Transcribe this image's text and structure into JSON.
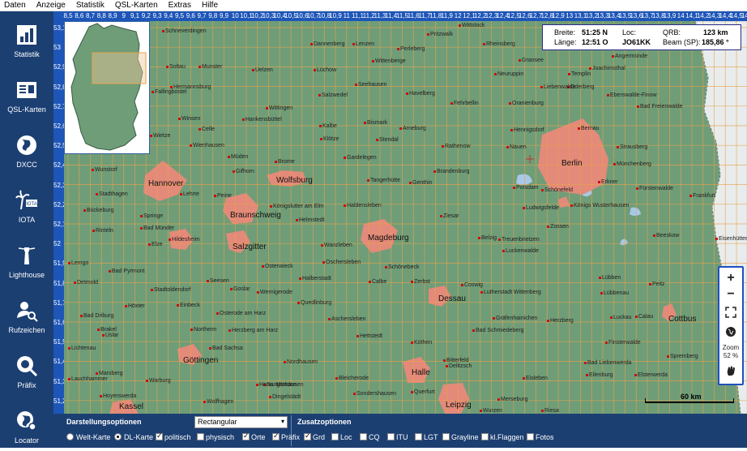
{
  "menu": [
    "Daten",
    "Anzeige",
    "Statistik",
    "QSL-Karten",
    "Extras",
    "Hilfe"
  ],
  "sidebar": [
    {
      "label": "Statistik",
      "icon": "chart-icon"
    },
    {
      "label": "QSL-Karten",
      "icon": "qsl-card-icon"
    },
    {
      "label": "DXCC",
      "icon": "globe-icon"
    },
    {
      "label": "IOTA",
      "icon": "iota-palm-icon"
    },
    {
      "label": "Lighthouse",
      "icon": "lighthouse-icon"
    },
    {
      "label": "Rufzeichen",
      "icon": "person-search-icon"
    },
    {
      "label": "Präfix",
      "icon": "globe-search-icon"
    },
    {
      "label": "Locator",
      "icon": "globe-pin-icon"
    }
  ],
  "ruler_top": [
    "8,5",
    "8,6",
    "8,7",
    "8,8",
    "8,9",
    "9",
    "9,1",
    "9,2",
    "9,3",
    "9,4",
    "9,5",
    "9,6",
    "9,7",
    "9,8",
    "9,9",
    "10",
    "10,1",
    "10,2",
    "10,3",
    "10,4",
    "10,5",
    "10,6",
    "10,7",
    "10,8",
    "10,9",
    "11",
    "11,1",
    "11,2",
    "11,3",
    "11,4",
    "11,5",
    "11,6",
    "11,7",
    "11,8",
    "11,9",
    "12",
    "12,1",
    "12,2",
    "12,3",
    "12,4",
    "12,5",
    "12,6",
    "12,7",
    "12,8",
    "12,9",
    "13",
    "13,1",
    "13,2",
    "13,3",
    "13,4",
    "13,5",
    "13,6",
    "13,7",
    "13,8",
    "13,9",
    "14",
    "14,1",
    "14,2",
    "14,3",
    "14,4",
    "14,5",
    "14,6"
  ],
  "ruler_left": [
    "53,1",
    "53",
    "52,9",
    "52,8",
    "52,7",
    "52,6",
    "52,5",
    "52,4",
    "52,3",
    "52,2",
    "52,1",
    "52",
    "51,9",
    "51,8",
    "51,7",
    "51,6",
    "51,5",
    "51,4",
    "51,3",
    "51,2"
  ],
  "info": {
    "breite_label": "Breite:",
    "breite": "51:25 N",
    "laenge_label": "Länge:",
    "laenge": "12:51 O",
    "loc_label": "Loc:",
    "loc": "JO61KK",
    "qrb_label": "QRB:",
    "qrb": "123 km",
    "beam_label": "Beam (SP):",
    "beam": "185,86 °"
  },
  "zoom": {
    "label": "Zoom",
    "value": "52 %"
  },
  "scale_label": "60 km",
  "big_cities": [
    "Hannover",
    "Wolfsburg",
    "Braunschweig",
    "Salzgitter",
    "Magdeburg",
    "Berlin",
    "Dessau",
    "Göttingen",
    "Halle",
    "Leipzig",
    "Kassel",
    "Cottbus"
  ],
  "cities": [
    "Schneverdingen",
    "Dannenberg",
    "Lenzen",
    "Pritzwalk",
    "Wittstock",
    "Rheinsberg",
    "Gransee",
    "Angermünde",
    "Joachimsthal",
    "Uelzen",
    "Soltau",
    "Munster",
    "Lüchow",
    "Wittenberge",
    "Perleberg",
    "Neuruppin",
    "Templin",
    "Hermannsburg",
    "Seehausen",
    "Havelberg",
    "Oderberg",
    "Liebenwalde",
    "Eberswalde-Finow",
    "Fallingbostel",
    "Salzwedel",
    "Fehrbellin",
    "Oranienburg",
    "Bad Freienwalde",
    "Wittingen",
    "Celle",
    "Winsen",
    "Hankensbüttel",
    "Bismark",
    "Kalbe",
    "Arneburg",
    "Stendal",
    "Hennigsdorf",
    "Bernau",
    "Wietze",
    "Wienhausen",
    "Klötze",
    "Rathenow",
    "Nauen",
    "Strausberg",
    "Müden",
    "Gardelegen",
    "Wunstorf",
    "Gifhorn",
    "Brome",
    "Tangerhütte",
    "Brandenburg",
    "Genthin",
    "Potsdam",
    "Münchenberg",
    "Lehrte",
    "Peine",
    "Haldensleben",
    "Schönefeld",
    "Erkner",
    "Fürstenwalde",
    "Stadthagen",
    "Springe",
    "Königslutter am Elm",
    "Helmstedt",
    "Ludwigsfelde",
    "Ziesar",
    "Königs Wusterhausen",
    "Frankfurt",
    "Bückeburg",
    "Hildesheim",
    "Bad Münder",
    "Zossen",
    "Rinteln",
    "Elze",
    "Wanzleben",
    "Belzig",
    "Treuenbrietzen",
    "Beeskow",
    "Eisenhüttenstadt",
    "Oschersleben",
    "Luckenwalde",
    "Lemgo",
    "Bad Pyrmont",
    "Osterwieck",
    "Schönebeck",
    "Detmold",
    "Stadtoldendorf",
    "Halberstadt",
    "Calbe",
    "Zerbst",
    "Coswig",
    "Lübben",
    "Peitz",
    "Seesen",
    "Goslar",
    "Wernigerode",
    "Lutherstadt Wittenberg",
    "Lübbenau",
    "Bad Driburg",
    "Höxter",
    "Einbeck",
    "Quedlinburg",
    "Aschersleben",
    "Gräfenhainichen",
    "Luckau",
    "Calau",
    "Brakel",
    "Northeim",
    "Osterode am Harz",
    "Herzberg am Harz",
    "Bad Schmiedeberg",
    "Herzberg",
    "Uslar",
    "Bad Sachsa",
    "Hettstedt",
    "Köthen",
    "Finsterwalde",
    "Lichtenau",
    "Nordhausen",
    "Bitterfeld",
    "Spremberg",
    "Bad Liebenwerda",
    "Delitzsch",
    "Sangerhausen",
    "Eilenburg",
    "Lauchhammer",
    "Marsberg",
    "Warburg",
    "Hann. Münden",
    "Bleicherode",
    "Eisleben",
    "Elsterwerda",
    "Hoyerswerda",
    "Wolfhagen",
    "Dingelstädt",
    "Sondershausen",
    "Querfurt",
    "Merseburg",
    "Wurzen",
    "Riesa",
    "Torgau"
  ],
  "options": {
    "title": "Darstellungsoptionen",
    "select_value": "Rectangular",
    "welt": "Welt-Karte",
    "dl": "DL-Karte",
    "politisch": "politisch",
    "physisch": "physisch",
    "zusatz_title": "Zusatzoptionen",
    "checks": [
      {
        "label": "Orte",
        "on": true
      },
      {
        "label": "Präfix",
        "on": true
      },
      {
        "label": "Grd",
        "on": true
      },
      {
        "label": "Loc",
        "on": false
      },
      {
        "label": "CQ",
        "on": false
      },
      {
        "label": "ITU",
        "on": false
      },
      {
        "label": "LGT",
        "on": false
      },
      {
        "label": "Grayline",
        "on": false
      },
      {
        "label": "kl.Flaggen",
        "on": false
      },
      {
        "label": "Fotos",
        "on": false
      }
    ]
  },
  "colors": {
    "sidebar": "#1c3f72",
    "ruler": "#1e56b8",
    "land": "#6f9d78",
    "city": "#e38a7a",
    "grid": "#e8a34a",
    "poland": "#e9ecec",
    "water": "#a8c8e8"
  }
}
